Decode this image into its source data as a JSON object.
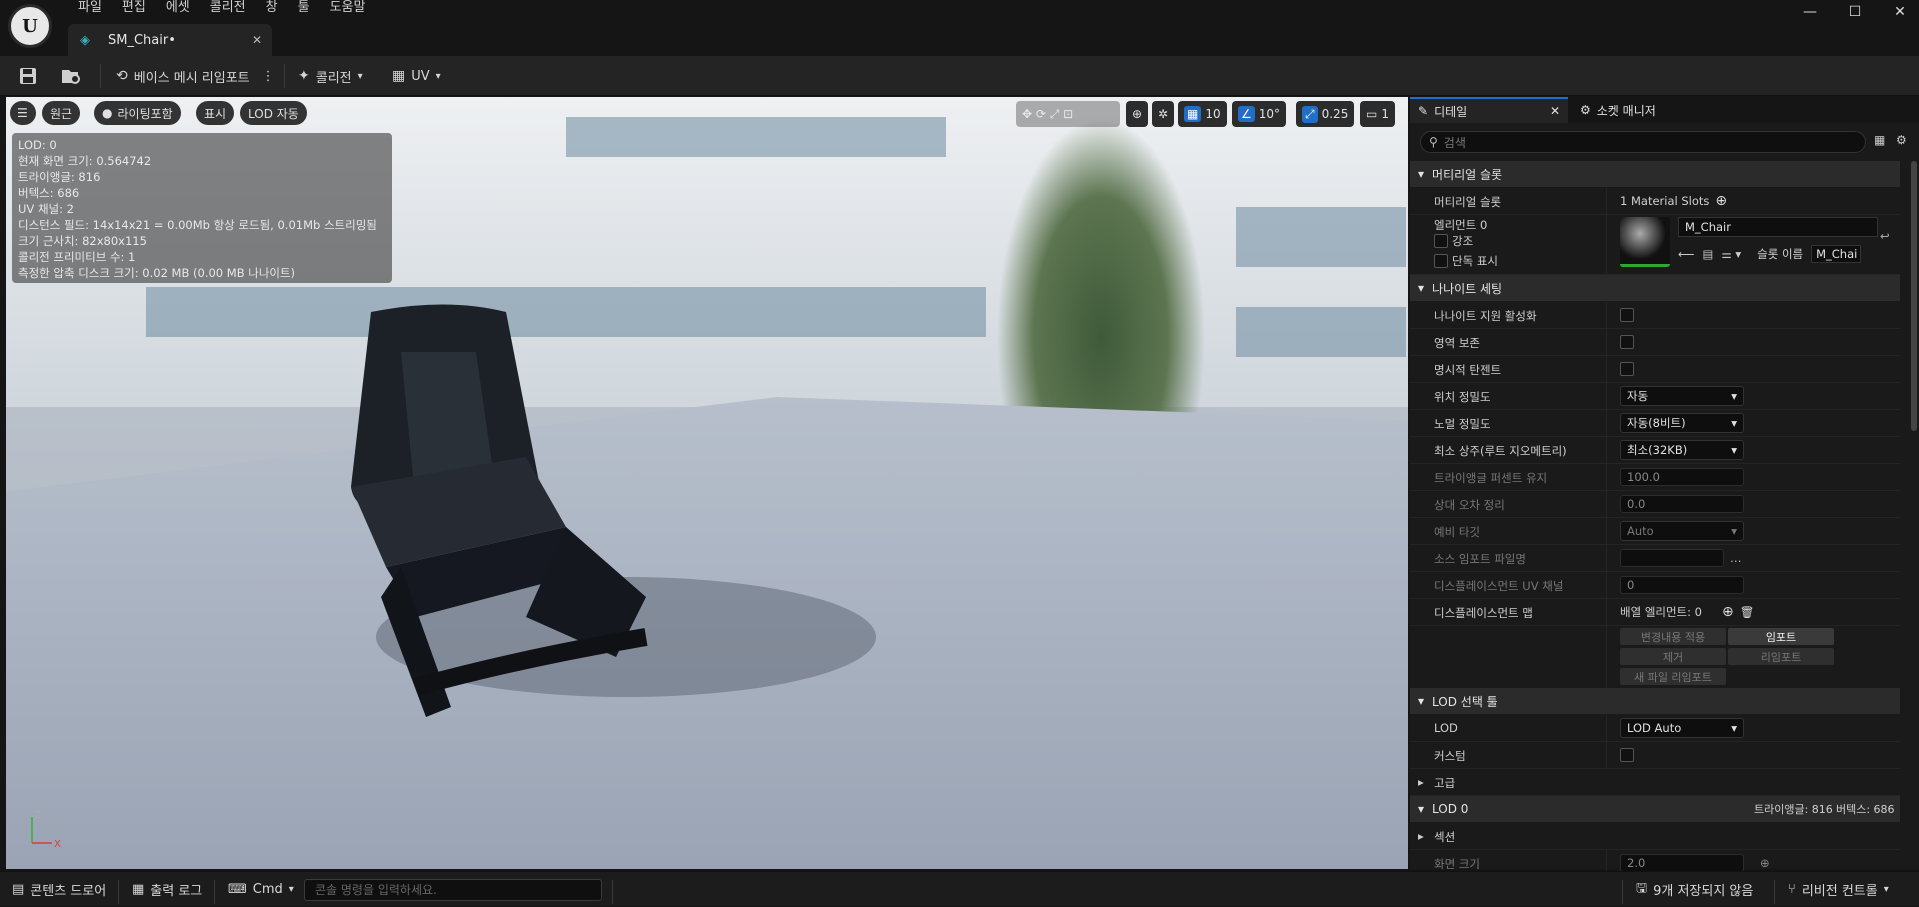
{
  "app": {
    "logo_text": "U"
  },
  "menu": [
    "파일",
    "편집",
    "에셋",
    "콜리전",
    "창",
    "툴",
    "도움말"
  ],
  "window_controls": {
    "minimize": "—",
    "maximize": "☐",
    "close": "✕"
  },
  "tab": {
    "label": "SM_Chair•",
    "close": "✕"
  },
  "toolbar": {
    "reimport_label": "베이스 메시 리임포트",
    "collision_label": "콜리전",
    "uv_label": "UV"
  },
  "viewport": {
    "perspective": "원근",
    "lighting": "라이팅포함",
    "show": "표시",
    "lod": "LOD 자동",
    "grid_value": "10",
    "angle_value": "10°",
    "scale_value": "0.25",
    "camera_value": "1",
    "stats": [
      "LOD:  0",
      "현재 화면 크기: 0.564742",
      "트라이앵글: 816",
      "버텍스: 686",
      "UV 채널: 2",
      "디스턴스 필드: 14x14x21 = 0.00Mb 항상 로드됨, 0.01Mb 스트리밍됨",
      "크기 근사치: 82x80x115",
      "콜리전 프리미티브 수: 1",
      "측정한 압축 디스크 크기: 0.02 MB (0.00 MB 나나이트)"
    ],
    "axis_z": "Z",
    "axis_x": "X"
  },
  "details": {
    "tab_details": "디테일",
    "tab_socket": "소켓 매니저",
    "search_placeholder": "검색",
    "sec_material": "머티리얼 슬롯",
    "material_slots_label": "머티리얼 슬롯",
    "material_slots_value": "1 Material Slots",
    "element0": "엘리먼트 0",
    "highlight": "강조",
    "isolate": "단독 표시",
    "material_name": "M_Chair",
    "slot_name_label": "슬롯 이름",
    "slot_name_value": "M_Chai",
    "sec_nanite": "나나이트 세팅",
    "nanite_enable": "나나이트 지원 활성화",
    "preserve_area": "영역 보존",
    "explicit_tangents": "명시적 탄젠트",
    "position_precision": "위치 정밀도",
    "position_precision_value": "자동",
    "normal_precision": "노멀 정밀도",
    "normal_precision_value": "자동(8비트)",
    "min_resident": "최소 상주(루트 지오메트리)",
    "min_resident_value": "최소(32KB)",
    "keep_tri_percent": "트라이앵글 퍼센트 유지",
    "keep_tri_percent_value": "100.0",
    "trim_rel_error": "상대 오차 정리",
    "trim_rel_error_value": "0.0",
    "fallback_target": "예비 타깃",
    "fallback_target_value": "Auto",
    "source_import": "소스 임포트 파일명",
    "displacement_uv": "디스플레이스먼트 UV 채널",
    "displacement_uv_value": "0",
    "displacement_maps": "디스플레이스먼트 맵",
    "array_elements": "배열 엘리먼트: 0",
    "apply_changes": "변경내용 적용",
    "import": "임포트",
    "remove": "제거",
    "reimport": "리임포트",
    "reimport_new": "새 파일 리임포트",
    "sec_lod_picker": "LOD 선택 툴",
    "lod_label": "LOD",
    "lod_value": "LOD Auto",
    "custom": "커스텀",
    "advanced": "고급",
    "sec_lod0": "LOD 0",
    "lod0_tris": "트라이앵글: 816",
    "lod0_verts": "버텍스: 686",
    "sections": "섹션",
    "screen_size": "화면 크기",
    "screen_size_value": "2.0"
  },
  "statusbar": {
    "content_drawer": "콘텐츠 드로어",
    "output_log": "출력 로그",
    "cmd": "Cmd",
    "console_placeholder": "콘솔 명령을 입력하세요.",
    "unsaved": "9개 저장되지 않음",
    "revision": "리비전 컨트롤"
  }
}
